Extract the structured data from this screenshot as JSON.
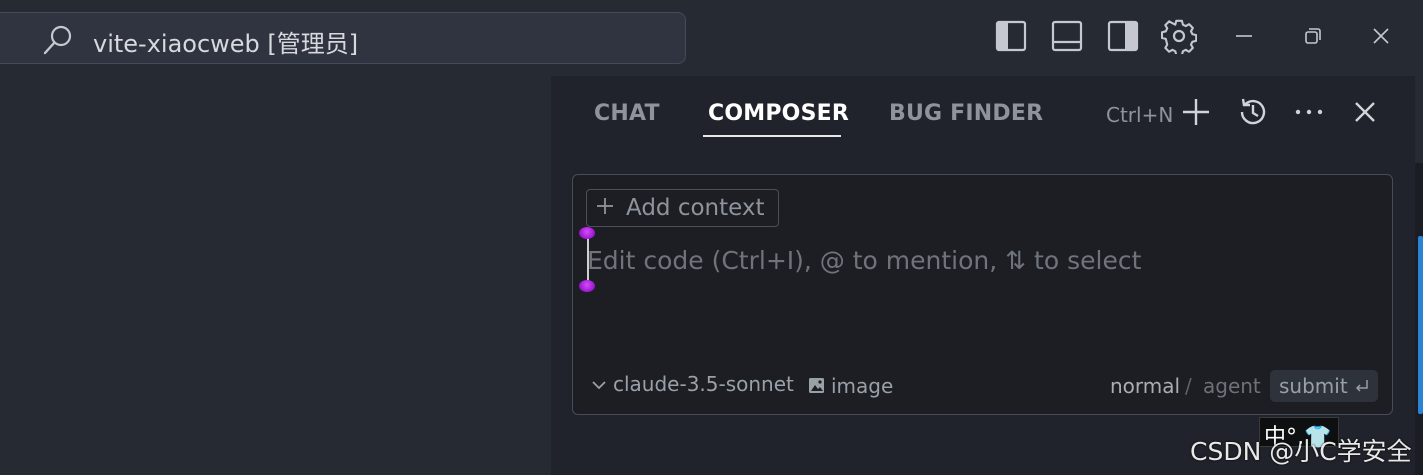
{
  "titlebar": {
    "search_text": "vite-xiaocweb [管理员]",
    "icons": [
      "toggle-primary-sidebar-icon",
      "toggle-panel-icon",
      "toggle-secondary-sidebar-icon",
      "settings-gear-icon",
      "minimize-icon",
      "restore-icon",
      "close-icon"
    ]
  },
  "panel": {
    "tabs": [
      {
        "label": "CHAT",
        "active": false
      },
      {
        "label": "COMPOSER",
        "active": true
      },
      {
        "label": "BUG FINDER",
        "active": false
      }
    ],
    "new_shortcut": "Ctrl+N",
    "actions": [
      "new-composer-icon",
      "history-icon",
      "more-icon",
      "close-panel-icon"
    ]
  },
  "composer": {
    "add_context_label": "Add context",
    "placeholder": "Edit code (Ctrl+I), @ to mention, ⇅ to select",
    "model": "claude-3.5-sonnet",
    "image_label": "image",
    "mode_normal": "normal",
    "mode_separator": "/",
    "mode_agent": "agent",
    "submit_label": "submit"
  },
  "overlay": {
    "ime_text": "中°,👕",
    "watermark": "CSDN @小C学安全"
  },
  "colors": {
    "background": "#262a33",
    "panel": "#20232b",
    "composer": "#1c1e23",
    "accent_scroll": "#2b83d6",
    "caret_handle": "#a400d6"
  }
}
